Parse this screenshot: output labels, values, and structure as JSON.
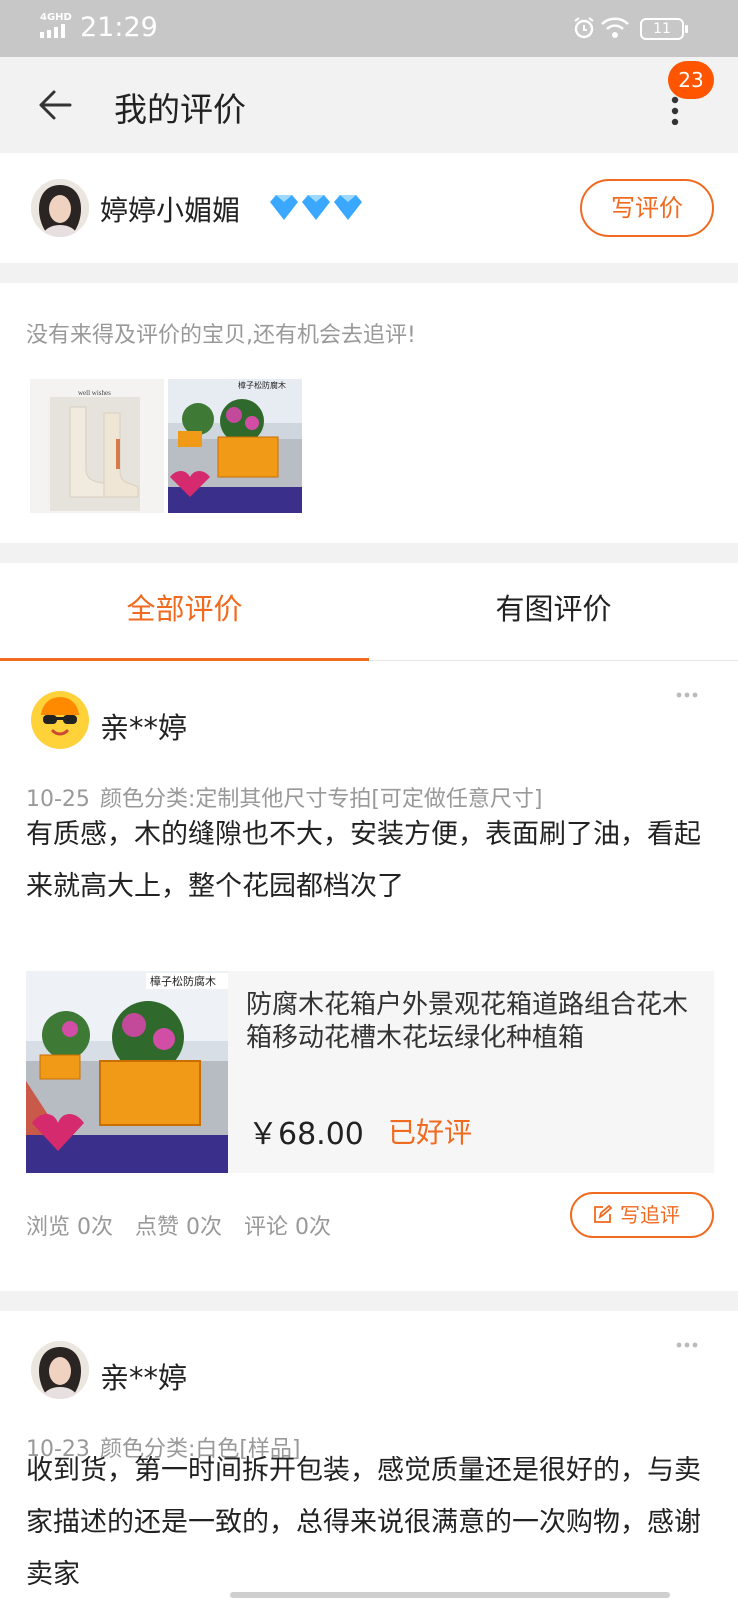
{
  "status_bar": {
    "network": "4GHD",
    "time": "21:29",
    "battery": "11"
  },
  "header": {
    "title": "我的评价",
    "badge_count": "23"
  },
  "user": {
    "name": "婷婷小媚媚",
    "diamond_count": 3,
    "write_review_label": "写评价"
  },
  "followup": {
    "tip": "没有来得及评价的宝贝,还有机会去追评!",
    "thumb1_caption": "well wishes",
    "thumb2_caption": "樟子松防腐木"
  },
  "tabs": [
    {
      "label": "全部评价",
      "active": true
    },
    {
      "label": "有图评价",
      "active": false
    }
  ],
  "reviews": [
    {
      "user": "亲**婷",
      "date": "10-25",
      "sku": "颜色分类:定制其他尺寸专拍[可定做任意尺寸]",
      "text": "有质感，木的缝隙也不大，安装方便，表面刷了油，看起来就高大上，整个花园都档次了",
      "product": {
        "image_caption": "樟子松防腐木",
        "title": "防腐木花箱户外景观花箱道路组合花木箱移动花槽木花坛绿化种植箱",
        "price": "￥68.00",
        "status": "已好评"
      },
      "stats": {
        "views": "浏览 0次",
        "likes": "点赞 0次",
        "comments": "评论 0次"
      },
      "followup_label": "写追评"
    },
    {
      "user": "亲**婷",
      "date": "10-23",
      "sku": "颜色分类:白色[样品]",
      "text": "收到货，第一时间拆开包装，感觉质量还是很好的，与卖家描述的还是一致的，总得来说很满意的一次购物，感谢卖家"
    }
  ],
  "colors": {
    "accent": "#f06a20",
    "badge": "#ff5500",
    "muted": "#999999"
  },
  "icons": [
    "signal-icon",
    "alarm-icon",
    "wifi-icon",
    "battery-icon",
    "back-arrow-icon",
    "more-vertical-icon",
    "diamond-icon",
    "more-horizontal-icon",
    "edit-icon"
  ]
}
